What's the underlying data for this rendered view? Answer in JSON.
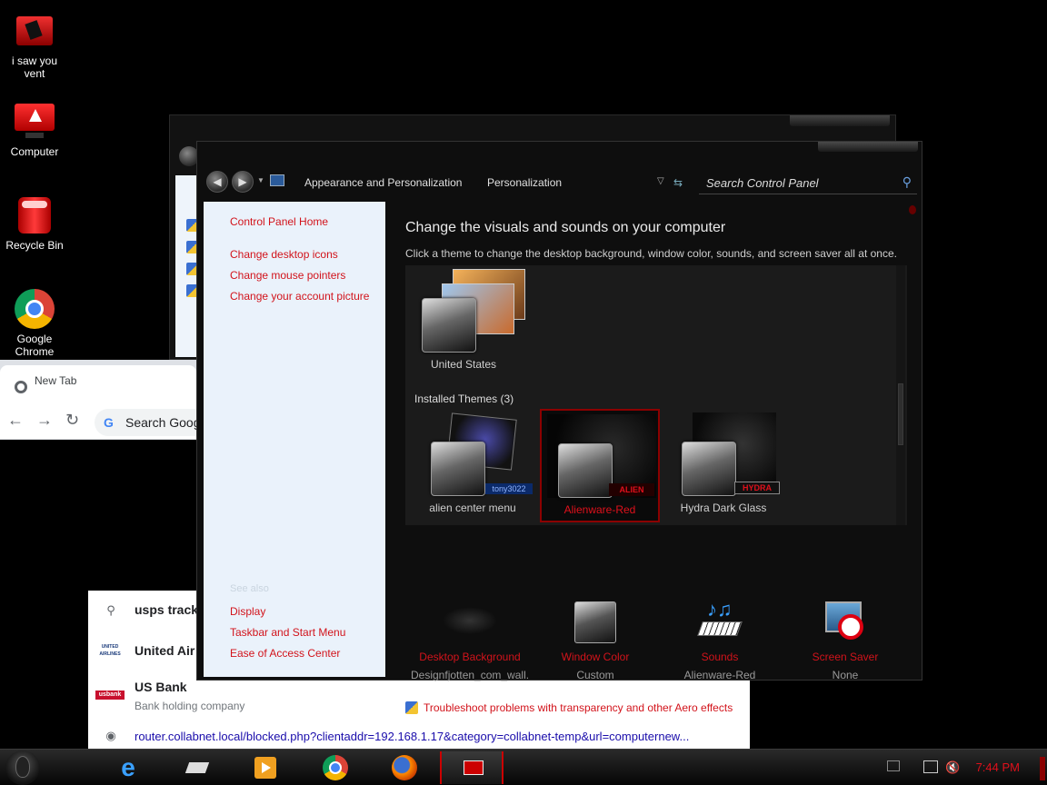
{
  "desktop": {
    "icons": [
      {
        "label": "i saw you vent"
      },
      {
        "label": "Computer"
      },
      {
        "label": "Recycle Bin"
      },
      {
        "label": "Google Chrome"
      }
    ]
  },
  "chrome": {
    "tab_title": "New Tab",
    "omnibox_text": "Search Goog",
    "suggestions": [
      {
        "title": "usps tracki",
        "subtitle": ""
      },
      {
        "title": "United Air",
        "subtitle": ""
      },
      {
        "title": "US Bank",
        "subtitle": "Bank holding company"
      },
      {
        "title": "router.collabnet.local/blocked.php?clientaddr=192.168.1.17&category=collabnet-temp&url=computernew...",
        "subtitle": ""
      }
    ],
    "united_logo_text": "UNITED AIRLINES",
    "usbank_logo_text": "usbank"
  },
  "control_panel": {
    "breadcrumb": [
      "Appearance and Personalization",
      "Personalization"
    ],
    "search_placeholder": "Search Control Panel",
    "left_links": [
      "Control Panel Home",
      "Change desktop icons",
      "Change mouse pointers",
      "Change your account picture"
    ],
    "see_also_label": "See also",
    "see_also_links": [
      "Display",
      "Taskbar and Start Menu",
      "Ease of Access Center"
    ],
    "title": "Change the visuals and sounds on your computer",
    "subtitle": "Click a theme to change the desktop background, window color, sounds, and screen saver all at once.",
    "top_theme": "United States",
    "installed_label": "Installed Themes (3)",
    "installed_themes": [
      {
        "name": "alien center menu",
        "badge": "tony3022"
      },
      {
        "name": "Alienware-Red",
        "badge": "ALIEN"
      },
      {
        "name": "Hydra Dark Glass",
        "badge": "HYDRA"
      }
    ],
    "settings": [
      {
        "label": "Desktop Background",
        "value": "Designfjotten_com_wall..."
      },
      {
        "label": "Window Color",
        "value": "Custom"
      },
      {
        "label": "Sounds",
        "value": "Alienware-Red"
      },
      {
        "label": "Screen Saver",
        "value": "None"
      }
    ],
    "troubleshoot": "Troubleshoot problems with transparency and other Aero effects"
  },
  "taskbar": {
    "clock": "7:44 PM"
  },
  "colors": {
    "accent_red": "#d2131b",
    "panel_bg": "#0e0e0e",
    "left_pane_bg": "#eaf2fb"
  }
}
